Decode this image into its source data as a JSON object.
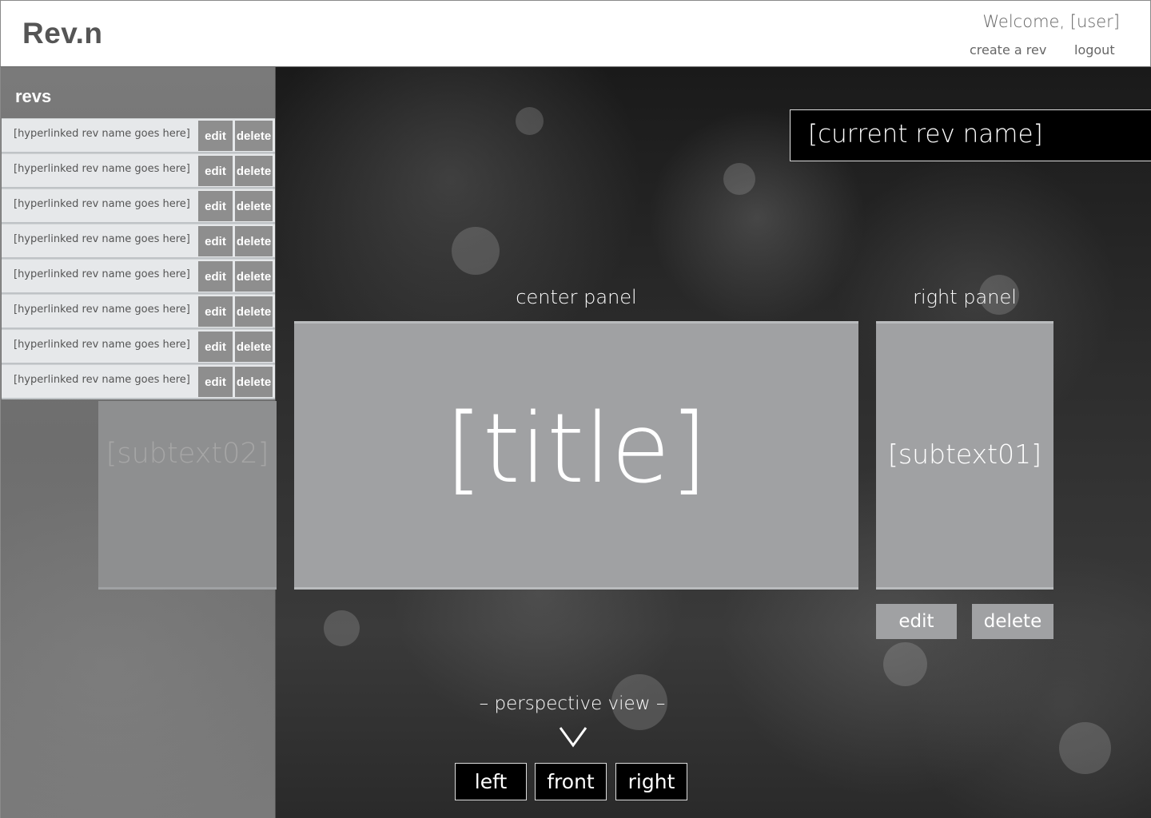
{
  "header": {
    "logo": "Rev.n",
    "welcome": "Welcome, [user]",
    "create_link": "create a rev",
    "logout_link": "logout"
  },
  "sidebar": {
    "heading": "revs",
    "items": [
      {
        "name": "[hyperlinked rev name goes here]",
        "edit": "edit",
        "delete": "delete"
      },
      {
        "name": "[hyperlinked rev name goes here]",
        "edit": "edit",
        "delete": "delete"
      },
      {
        "name": "[hyperlinked rev name goes here]",
        "edit": "edit",
        "delete": "delete"
      },
      {
        "name": "[hyperlinked rev name goes here]",
        "edit": "edit",
        "delete": "delete"
      },
      {
        "name": "[hyperlinked rev name goes here]",
        "edit": "edit",
        "delete": "delete"
      },
      {
        "name": "[hyperlinked rev name goes here]",
        "edit": "edit",
        "delete": "delete"
      },
      {
        "name": "[hyperlinked rev name goes here]",
        "edit": "edit",
        "delete": "delete"
      },
      {
        "name": "[hyperlinked rev name goes here]",
        "edit": "edit",
        "delete": "delete"
      }
    ],
    "subtext02": "[subtext02]"
  },
  "main": {
    "current_rev_name": "[current rev name]",
    "center_panel": {
      "label": "center panel",
      "title": "[title]"
    },
    "right_panel": {
      "label": "right panel",
      "subtext01": "[subtext01]",
      "edit_label": "edit",
      "delete_label": "delete"
    },
    "perspective": {
      "label": "– perspective view –",
      "icon": "chevron-down-icon",
      "views": [
        "left",
        "front",
        "right"
      ]
    }
  },
  "colors": {
    "panel": "#a0a1a3",
    "sidebar_row": "#e6e8ea",
    "button_gray": "#8e8e8e"
  }
}
